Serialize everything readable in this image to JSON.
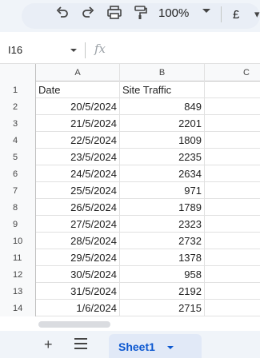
{
  "toolbar": {
    "zoom": "100%",
    "currency": "£",
    "icons": [
      "search-icon",
      "undo-icon",
      "redo-icon",
      "print-icon",
      "paint-format-icon"
    ]
  },
  "formula_bar": {
    "name_box": "I16",
    "fx_label": "fx"
  },
  "grid": {
    "columns": [
      "A",
      "B",
      "C"
    ],
    "rows": [
      {
        "num": "1",
        "a": "Date",
        "b": "Site Traffic"
      },
      {
        "num": "2",
        "a": "20/5/2024",
        "b": "849"
      },
      {
        "num": "3",
        "a": "21/5/2024",
        "b": "2201"
      },
      {
        "num": "4",
        "a": "22/5/2024",
        "b": "1809"
      },
      {
        "num": "5",
        "a": "23/5/2024",
        "b": "2235"
      },
      {
        "num": "6",
        "a": "24/5/2024",
        "b": "2634"
      },
      {
        "num": "7",
        "a": "25/5/2024",
        "b": "971"
      },
      {
        "num": "8",
        "a": "26/5/2024",
        "b": "1789"
      },
      {
        "num": "9",
        "a": "27/5/2024",
        "b": "2323"
      },
      {
        "num": "10",
        "a": "28/5/2024",
        "b": "2732"
      },
      {
        "num": "11",
        "a": "29/5/2024",
        "b": "1378"
      },
      {
        "num": "12",
        "a": "30/5/2024",
        "b": "958"
      },
      {
        "num": "13",
        "a": "31/5/2024",
        "b": "2192"
      },
      {
        "num": "14",
        "a": "1/6/2024",
        "b": "2715"
      }
    ]
  },
  "sheets": {
    "add_label": "+",
    "active_sheet": "Sheet1"
  }
}
